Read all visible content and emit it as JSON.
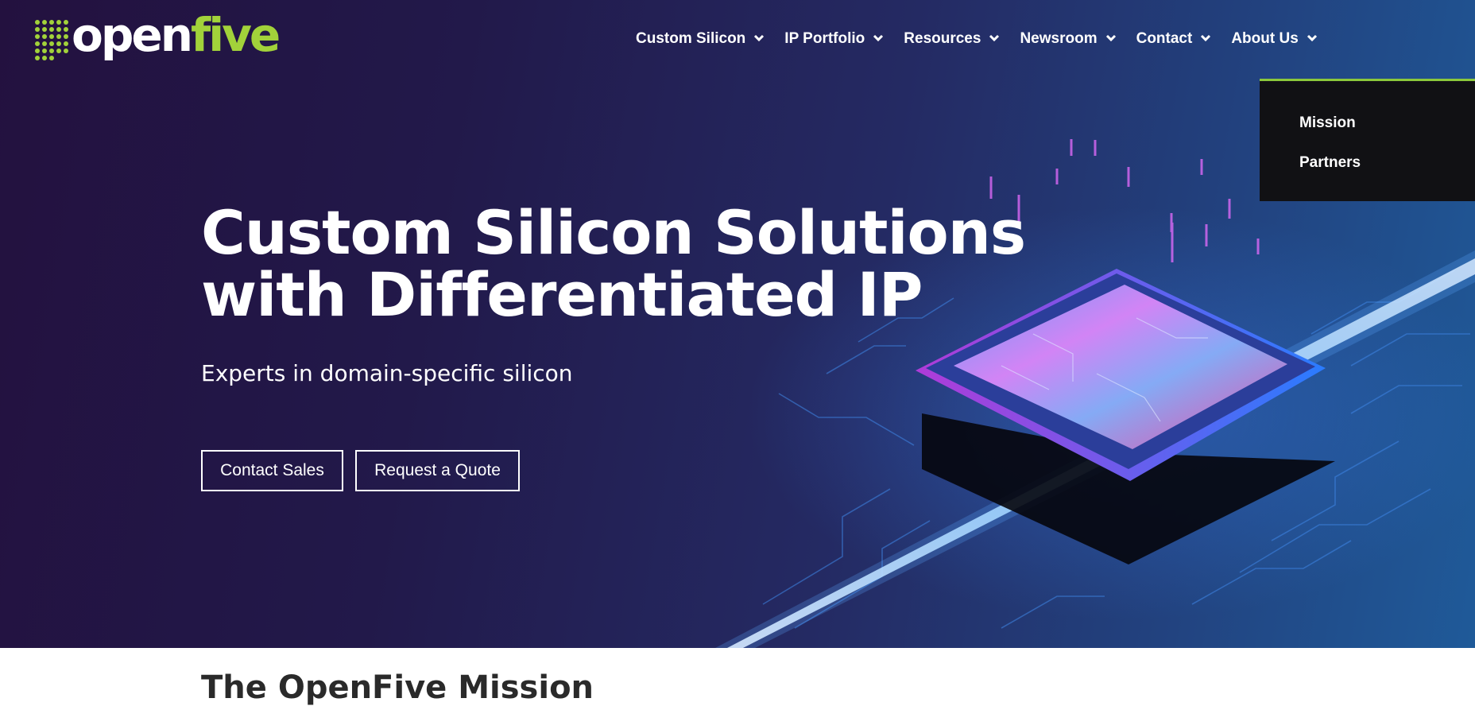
{
  "brand": {
    "logo_main": "open",
    "logo_accent": "five",
    "accent_color": "#a2d23a"
  },
  "nav": {
    "items": [
      {
        "label": "Custom Silicon"
      },
      {
        "label": "IP Portfolio"
      },
      {
        "label": "Resources"
      },
      {
        "label": "Newsroom"
      },
      {
        "label": "Contact"
      },
      {
        "label": "About Us"
      }
    ],
    "dropdown": {
      "parent": "About Us",
      "items": [
        "Mission",
        "Partners"
      ],
      "border_color": "#8cc83c"
    }
  },
  "hero": {
    "title_line1": "Custom Silicon Solutions",
    "title_line2": "with Differentiated IP",
    "subtitle": "Experts in domain-specific silicon",
    "buttons": {
      "contact_label": "Contact Sales",
      "quote_label": "Request a Quote"
    }
  },
  "mission": {
    "title": "The OpenFive Mission"
  }
}
